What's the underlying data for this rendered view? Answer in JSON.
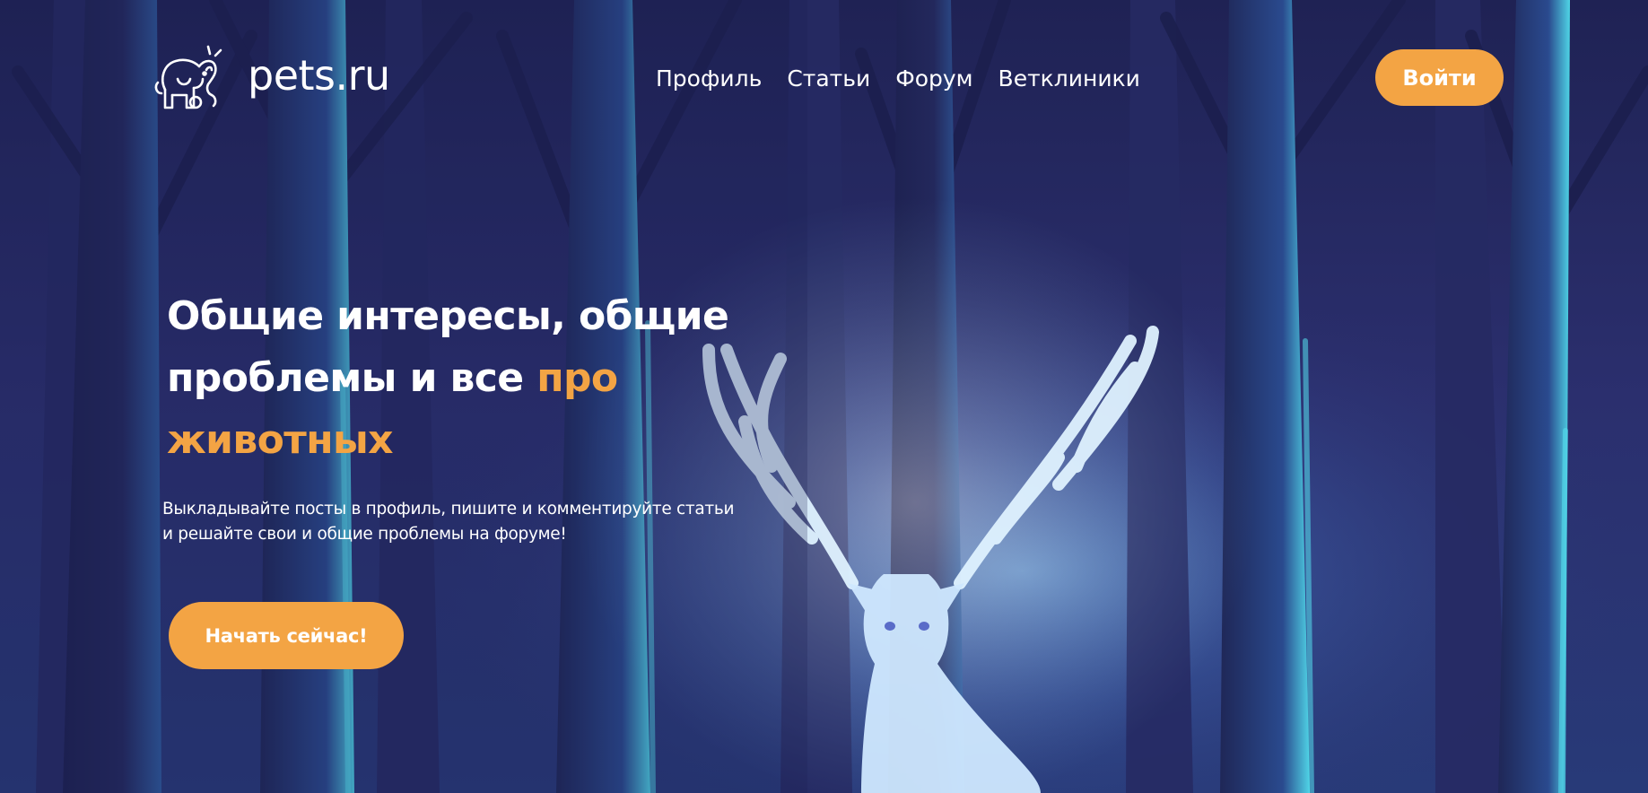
{
  "header": {
    "logo_icon": "elephant-logo-icon",
    "logo_text": "pets.ru",
    "nav": [
      {
        "label": "Профиль"
      },
      {
        "label": "Статьи"
      },
      {
        "label": "Форум"
      },
      {
        "label": "Ветклиники"
      }
    ],
    "login_label": "Войти"
  },
  "hero": {
    "title_part1": "Общие интересы, общие проблемы и все ",
    "title_accent": "про животных",
    "subtitle_line1": "Выкладывайте посты в профиль, пишите и комментируйте статьи",
    "subtitle_line2": "и решайте свои и общие проблемы на форуме!",
    "cta_label": "Начать сейчас!",
    "background_image": "glowing-stag-in-night-forest"
  },
  "colors": {
    "accent": "#f3a444",
    "background": "#25285e",
    "text": "#ffffff",
    "glow": "#bfe6ff"
  }
}
